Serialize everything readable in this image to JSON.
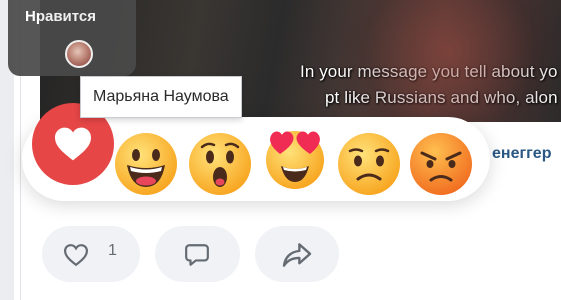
{
  "likes_popup": {
    "title": "Нравится",
    "avatar_icon": "user-avatar"
  },
  "tooltip": {
    "text": "Марьяна Наумова"
  },
  "video": {
    "subtitle_line1": "In your message you tell about yo",
    "subtitle_line2": "pt like Russians and who, alon"
  },
  "reactions": {
    "selected": "heart-icon",
    "selected_color": "#e64646",
    "items": [
      "heart-icon",
      "laughing-face-icon",
      "surprised-face-icon",
      "heart-eyes-face-icon",
      "sad-face-icon",
      "angry-face-icon"
    ]
  },
  "author_partial": "енеггер",
  "actions": {
    "like_count": "1",
    "like_icon": "heart-outline-icon",
    "comment_icon": "comment-icon",
    "share_icon": "share-icon"
  },
  "colors": {
    "accent": "#2a5885",
    "button_bg": "#f0f2f5",
    "icon": "#656b73"
  }
}
